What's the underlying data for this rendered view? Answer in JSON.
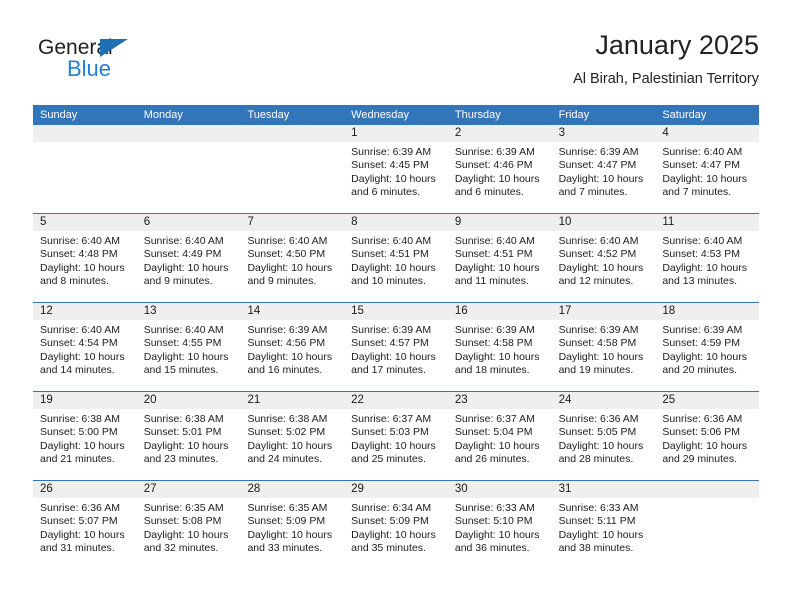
{
  "brand": {
    "name_part1": "General",
    "name_part2": "Blue",
    "accent_color": "#1f7fd4",
    "triangle_color": "#1f6fb5"
  },
  "header": {
    "title": "January 2025",
    "subtitle": "Al Birah, Palestinian Territory"
  },
  "calendar": {
    "header_color": "#3275b8",
    "daynum_band_color": "#efefef",
    "weekdays": [
      "Sunday",
      "Monday",
      "Tuesday",
      "Wednesday",
      "Thursday",
      "Friday",
      "Saturday"
    ],
    "weeks": [
      [
        {
          "day": "",
          "sunrise": "",
          "sunset": "",
          "daylight_line1": "",
          "daylight_line2": "",
          "empty": true
        },
        {
          "day": "",
          "sunrise": "",
          "sunset": "",
          "daylight_line1": "",
          "daylight_line2": "",
          "empty": true
        },
        {
          "day": "",
          "sunrise": "",
          "sunset": "",
          "daylight_line1": "",
          "daylight_line2": "",
          "empty": true
        },
        {
          "day": "1",
          "sunrise": "Sunrise: 6:39 AM",
          "sunset": "Sunset: 4:45 PM",
          "daylight_line1": "Daylight: 10 hours",
          "daylight_line2": "and 6 minutes."
        },
        {
          "day": "2",
          "sunrise": "Sunrise: 6:39 AM",
          "sunset": "Sunset: 4:46 PM",
          "daylight_line1": "Daylight: 10 hours",
          "daylight_line2": "and 6 minutes."
        },
        {
          "day": "3",
          "sunrise": "Sunrise: 6:39 AM",
          "sunset": "Sunset: 4:47 PM",
          "daylight_line1": "Daylight: 10 hours",
          "daylight_line2": "and 7 minutes."
        },
        {
          "day": "4",
          "sunrise": "Sunrise: 6:40 AM",
          "sunset": "Sunset: 4:47 PM",
          "daylight_line1": "Daylight: 10 hours",
          "daylight_line2": "and 7 minutes."
        }
      ],
      [
        {
          "day": "5",
          "sunrise": "Sunrise: 6:40 AM",
          "sunset": "Sunset: 4:48 PM",
          "daylight_line1": "Daylight: 10 hours",
          "daylight_line2": "and 8 minutes."
        },
        {
          "day": "6",
          "sunrise": "Sunrise: 6:40 AM",
          "sunset": "Sunset: 4:49 PM",
          "daylight_line1": "Daylight: 10 hours",
          "daylight_line2": "and 9 minutes."
        },
        {
          "day": "7",
          "sunrise": "Sunrise: 6:40 AM",
          "sunset": "Sunset: 4:50 PM",
          "daylight_line1": "Daylight: 10 hours",
          "daylight_line2": "and 9 minutes."
        },
        {
          "day": "8",
          "sunrise": "Sunrise: 6:40 AM",
          "sunset": "Sunset: 4:51 PM",
          "daylight_line1": "Daylight: 10 hours",
          "daylight_line2": "and 10 minutes."
        },
        {
          "day": "9",
          "sunrise": "Sunrise: 6:40 AM",
          "sunset": "Sunset: 4:51 PM",
          "daylight_line1": "Daylight: 10 hours",
          "daylight_line2": "and 11 minutes."
        },
        {
          "day": "10",
          "sunrise": "Sunrise: 6:40 AM",
          "sunset": "Sunset: 4:52 PM",
          "daylight_line1": "Daylight: 10 hours",
          "daylight_line2": "and 12 minutes."
        },
        {
          "day": "11",
          "sunrise": "Sunrise: 6:40 AM",
          "sunset": "Sunset: 4:53 PM",
          "daylight_line1": "Daylight: 10 hours",
          "daylight_line2": "and 13 minutes."
        }
      ],
      [
        {
          "day": "12",
          "sunrise": "Sunrise: 6:40 AM",
          "sunset": "Sunset: 4:54 PM",
          "daylight_line1": "Daylight: 10 hours",
          "daylight_line2": "and 14 minutes."
        },
        {
          "day": "13",
          "sunrise": "Sunrise: 6:40 AM",
          "sunset": "Sunset: 4:55 PM",
          "daylight_line1": "Daylight: 10 hours",
          "daylight_line2": "and 15 minutes."
        },
        {
          "day": "14",
          "sunrise": "Sunrise: 6:39 AM",
          "sunset": "Sunset: 4:56 PM",
          "daylight_line1": "Daylight: 10 hours",
          "daylight_line2": "and 16 minutes."
        },
        {
          "day": "15",
          "sunrise": "Sunrise: 6:39 AM",
          "sunset": "Sunset: 4:57 PM",
          "daylight_line1": "Daylight: 10 hours",
          "daylight_line2": "and 17 minutes."
        },
        {
          "day": "16",
          "sunrise": "Sunrise: 6:39 AM",
          "sunset": "Sunset: 4:58 PM",
          "daylight_line1": "Daylight: 10 hours",
          "daylight_line2": "and 18 minutes."
        },
        {
          "day": "17",
          "sunrise": "Sunrise: 6:39 AM",
          "sunset": "Sunset: 4:58 PM",
          "daylight_line1": "Daylight: 10 hours",
          "daylight_line2": "and 19 minutes."
        },
        {
          "day": "18",
          "sunrise": "Sunrise: 6:39 AM",
          "sunset": "Sunset: 4:59 PM",
          "daylight_line1": "Daylight: 10 hours",
          "daylight_line2": "and 20 minutes."
        }
      ],
      [
        {
          "day": "19",
          "sunrise": "Sunrise: 6:38 AM",
          "sunset": "Sunset: 5:00 PM",
          "daylight_line1": "Daylight: 10 hours",
          "daylight_line2": "and 21 minutes."
        },
        {
          "day": "20",
          "sunrise": "Sunrise: 6:38 AM",
          "sunset": "Sunset: 5:01 PM",
          "daylight_line1": "Daylight: 10 hours",
          "daylight_line2": "and 23 minutes."
        },
        {
          "day": "21",
          "sunrise": "Sunrise: 6:38 AM",
          "sunset": "Sunset: 5:02 PM",
          "daylight_line1": "Daylight: 10 hours",
          "daylight_line2": "and 24 minutes."
        },
        {
          "day": "22",
          "sunrise": "Sunrise: 6:37 AM",
          "sunset": "Sunset: 5:03 PM",
          "daylight_line1": "Daylight: 10 hours",
          "daylight_line2": "and 25 minutes."
        },
        {
          "day": "23",
          "sunrise": "Sunrise: 6:37 AM",
          "sunset": "Sunset: 5:04 PM",
          "daylight_line1": "Daylight: 10 hours",
          "daylight_line2": "and 26 minutes."
        },
        {
          "day": "24",
          "sunrise": "Sunrise: 6:36 AM",
          "sunset": "Sunset: 5:05 PM",
          "daylight_line1": "Daylight: 10 hours",
          "daylight_line2": "and 28 minutes."
        },
        {
          "day": "25",
          "sunrise": "Sunrise: 6:36 AM",
          "sunset": "Sunset: 5:06 PM",
          "daylight_line1": "Daylight: 10 hours",
          "daylight_line2": "and 29 minutes."
        }
      ],
      [
        {
          "day": "26",
          "sunrise": "Sunrise: 6:36 AM",
          "sunset": "Sunset: 5:07 PM",
          "daylight_line1": "Daylight: 10 hours",
          "daylight_line2": "and 31 minutes."
        },
        {
          "day": "27",
          "sunrise": "Sunrise: 6:35 AM",
          "sunset": "Sunset: 5:08 PM",
          "daylight_line1": "Daylight: 10 hours",
          "daylight_line2": "and 32 minutes."
        },
        {
          "day": "28",
          "sunrise": "Sunrise: 6:35 AM",
          "sunset": "Sunset: 5:09 PM",
          "daylight_line1": "Daylight: 10 hours",
          "daylight_line2": "and 33 minutes."
        },
        {
          "day": "29",
          "sunrise": "Sunrise: 6:34 AM",
          "sunset": "Sunset: 5:09 PM",
          "daylight_line1": "Daylight: 10 hours",
          "daylight_line2": "and 35 minutes."
        },
        {
          "day": "30",
          "sunrise": "Sunrise: 6:33 AM",
          "sunset": "Sunset: 5:10 PM",
          "daylight_line1": "Daylight: 10 hours",
          "daylight_line2": "and 36 minutes."
        },
        {
          "day": "31",
          "sunrise": "Sunrise: 6:33 AM",
          "sunset": "Sunset: 5:11 PM",
          "daylight_line1": "Daylight: 10 hours",
          "daylight_line2": "and 38 minutes."
        },
        {
          "day": "",
          "sunrise": "",
          "sunset": "",
          "daylight_line1": "",
          "daylight_line2": "",
          "empty": true
        }
      ]
    ]
  }
}
